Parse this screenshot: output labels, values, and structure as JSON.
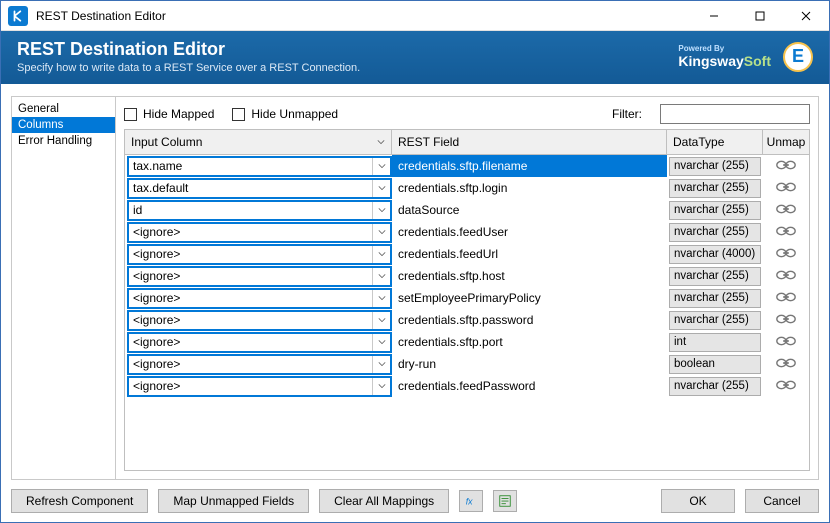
{
  "window": {
    "title": "REST Destination Editor"
  },
  "header": {
    "title": "REST Destination Editor",
    "subtitle": "Specify how to write data to a REST Service over a REST Connection.",
    "poweredBy": "Powered By",
    "brand1": "Kingsway",
    "brand2": "Soft",
    "brandE": "E"
  },
  "nav": {
    "items": [
      {
        "label": "General",
        "selected": false
      },
      {
        "label": "Columns",
        "selected": true
      },
      {
        "label": "Error Handling",
        "selected": false
      }
    ]
  },
  "options": {
    "hideMapped": "Hide Mapped",
    "hideUnmapped": "Hide Unmapped",
    "filterLabel": "Filter:",
    "filterValue": ""
  },
  "grid": {
    "headers": {
      "input": "Input Column",
      "rest": "REST Field",
      "datatype": "DataType",
      "unmap": "Unmap"
    },
    "rows": [
      {
        "input": "tax.name",
        "rest": "credentials.sftp.filename",
        "datatype": "nvarchar (255)",
        "selected": true
      },
      {
        "input": "tax.default",
        "rest": "credentials.sftp.login",
        "datatype": "nvarchar (255)",
        "selected": false
      },
      {
        "input": "id",
        "rest": "dataSource",
        "datatype": "nvarchar (255)",
        "selected": false
      },
      {
        "input": "<ignore>",
        "rest": "credentials.feedUser",
        "datatype": "nvarchar (255)",
        "selected": false
      },
      {
        "input": "<ignore>",
        "rest": "credentials.feedUrl",
        "datatype": "nvarchar (4000)",
        "selected": false
      },
      {
        "input": "<ignore>",
        "rest": "credentials.sftp.host",
        "datatype": "nvarchar (255)",
        "selected": false
      },
      {
        "input": "<ignore>",
        "rest": "setEmployeePrimaryPolicy",
        "datatype": "nvarchar (255)",
        "selected": false
      },
      {
        "input": "<ignore>",
        "rest": "credentials.sftp.password",
        "datatype": "nvarchar (255)",
        "selected": false
      },
      {
        "input": "<ignore>",
        "rest": "credentials.sftp.port",
        "datatype": "int",
        "selected": false
      },
      {
        "input": "<ignore>",
        "rest": "dry-run",
        "datatype": "boolean",
        "selected": false
      },
      {
        "input": "<ignore>",
        "rest": "credentials.feedPassword",
        "datatype": "nvarchar (255)",
        "selected": false
      }
    ]
  },
  "buttons": {
    "refresh": "Refresh Component",
    "mapUnmapped": "Map Unmapped Fields",
    "clearAll": "Clear All Mappings",
    "ok": "OK",
    "cancel": "Cancel"
  }
}
